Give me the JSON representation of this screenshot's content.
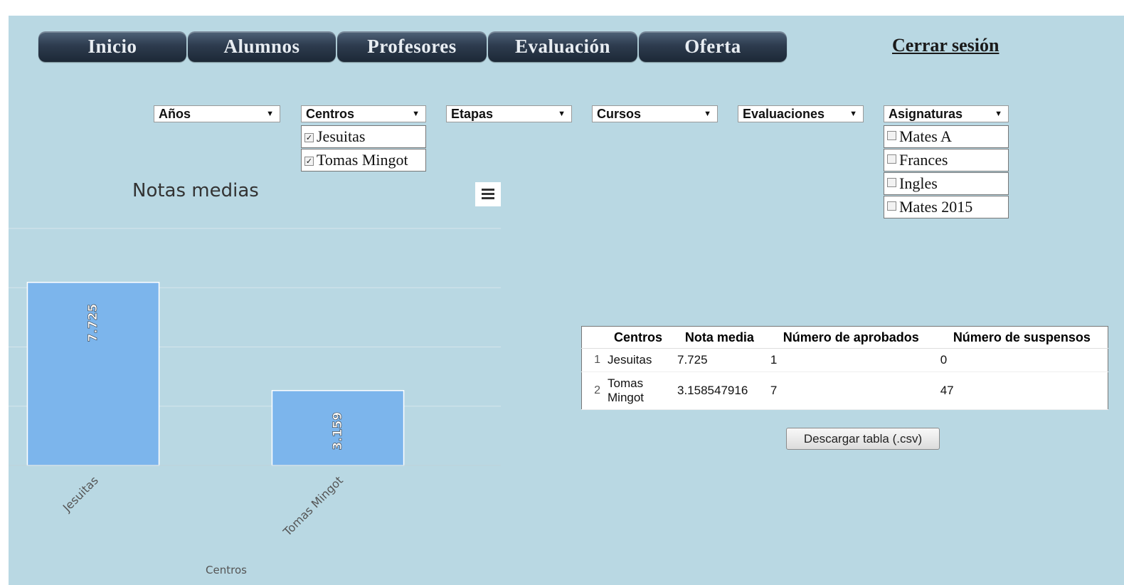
{
  "nav": {
    "items": [
      "Inicio",
      "Alumnos",
      "Profesores",
      "Evaluación",
      "Oferta"
    ],
    "logout": "Cerrar sesión"
  },
  "filters": {
    "anios": "Años",
    "centros": "Centros",
    "etapas": "Etapas",
    "cursos": "Cursos",
    "evaluaciones": "Evaluaciones",
    "asignaturas": "Asignaturas",
    "centros_options": [
      {
        "label": "Jesuitas",
        "checked": true
      },
      {
        "label": "Tomas Mingot",
        "checked": true
      }
    ],
    "asignaturas_options": [
      {
        "label": "Mates A",
        "checked": false
      },
      {
        "label": "Frances",
        "checked": false
      },
      {
        "label": "Ingles",
        "checked": false
      },
      {
        "label": "Mates 2015",
        "checked": false
      }
    ]
  },
  "chart_data": {
    "type": "bar",
    "title": "Notas medias",
    "categories": [
      "Jesuitas",
      "Tomas Mingot"
    ],
    "values": [
      7.725,
      3.159
    ],
    "data_labels": [
      "7.725",
      "3.159"
    ],
    "xlabel": "Centros",
    "ylabel": "",
    "ylim": [
      0,
      10
    ],
    "grid": true,
    "bar_color": "#7cb5ec"
  },
  "table": {
    "headers": [
      "Centros",
      "Nota media",
      "Número de aprobados",
      "Número de suspensos"
    ],
    "rows": [
      {
        "index": "1",
        "centro": "Jesuitas",
        "nota": "7.725",
        "aprobados": "1",
        "suspensos": "0"
      },
      {
        "index": "2",
        "centro": "Tomas Mingot",
        "nota": "3.158547916",
        "aprobados": "7",
        "suspensos": "47"
      }
    ]
  },
  "download_button": "Descargar tabla (.csv)"
}
